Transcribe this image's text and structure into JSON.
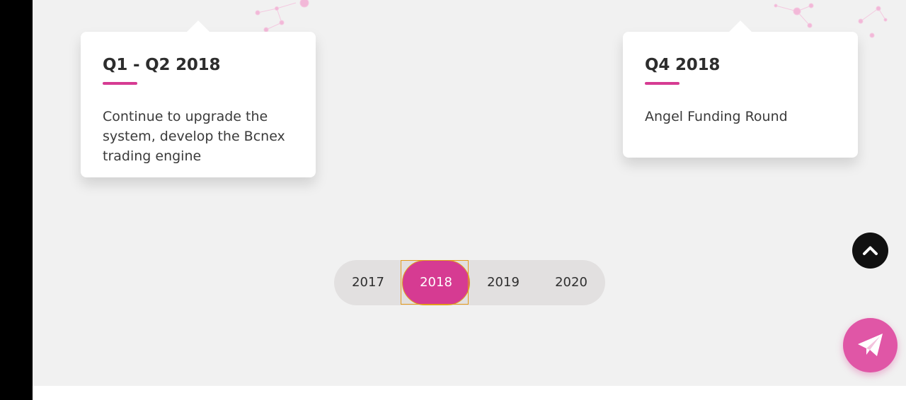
{
  "timeline": {
    "cards": [
      {
        "title": "Q1 - Q2 2018",
        "text": "Continue to upgrade the system, develop the Bcnex trading engine"
      },
      {
        "title": "Q4 2018",
        "text": "Angel Funding Round"
      }
    ],
    "years": [
      "2017",
      "2018",
      "2019",
      "2020"
    ],
    "selected_year": "2018"
  },
  "colors": {
    "accent": "#d63b92",
    "background": "#f1f1f1",
    "card": "#ffffff",
    "tab_track": "#e2e0e0",
    "scroll_button": "#111111",
    "telegram_button": "#e056a6"
  },
  "icons": {
    "scroll_top": "chevron-up-icon",
    "telegram": "telegram-paper-plane-icon"
  }
}
